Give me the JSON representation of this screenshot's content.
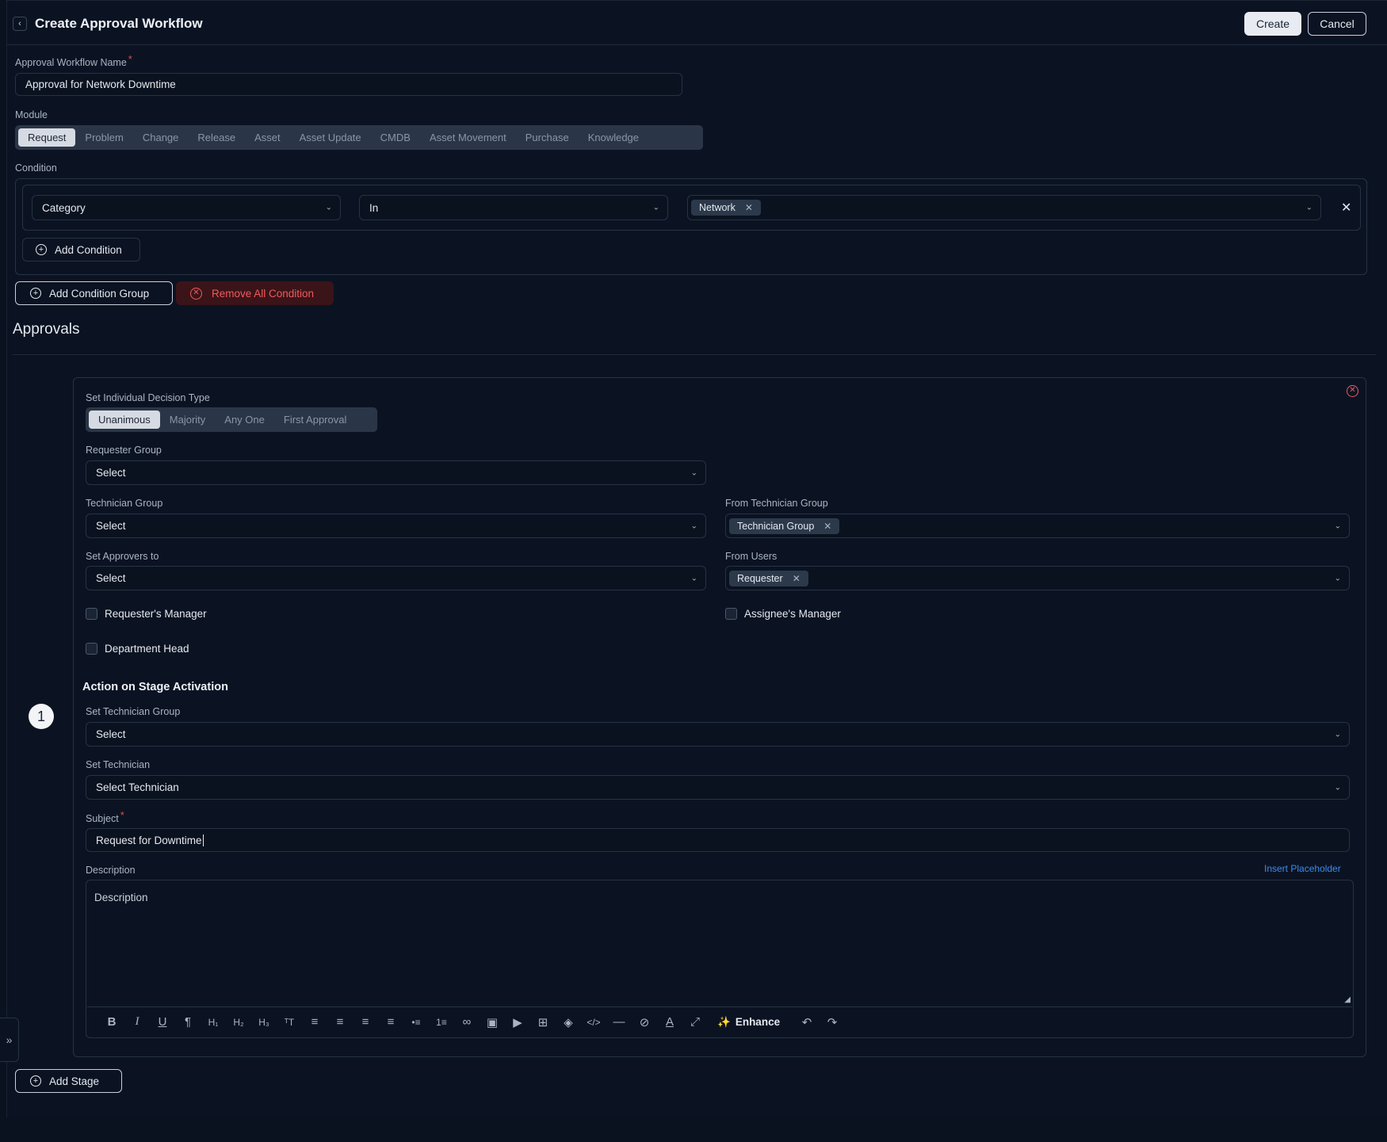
{
  "header": {
    "title": "Create Approval Workflow",
    "create_label": "Create",
    "cancel_label": "Cancel"
  },
  "workflow_name": {
    "label": "Approval Workflow Name",
    "required_mark": "*",
    "value": "Approval for Network Downtime"
  },
  "module": {
    "label": "Module",
    "options": [
      "Request",
      "Problem",
      "Change",
      "Release",
      "Asset",
      "Asset Update",
      "CMDB",
      "Asset Movement",
      "Purchase",
      "Knowledge"
    ],
    "selected": "Request"
  },
  "condition": {
    "label": "Condition",
    "field": "Category",
    "operator": "In",
    "value_tag": "Network",
    "add_condition_label": "Add Condition",
    "add_group_label": "Add Condition Group",
    "remove_all_label": "Remove All Condition"
  },
  "approvals": {
    "title": "Approvals",
    "stage_number": "1",
    "decision_type": {
      "label": "Set Individual Decision Type",
      "options": [
        "Unanimous",
        "Majority",
        "Any One",
        "First Approval"
      ],
      "selected": "Unanimous"
    },
    "requester_group": {
      "label": "Requester Group",
      "value": "Select"
    },
    "technician_group": {
      "label": "Technician Group",
      "value": "Select"
    },
    "from_technician_group": {
      "label": "From Technician Group",
      "tag": "Technician Group"
    },
    "set_approvers": {
      "label": "Set Approvers to",
      "value": "Select"
    },
    "from_users": {
      "label": "From Users",
      "tag": "Requester"
    },
    "checkboxes": {
      "requesters_manager": "Requester's Manager",
      "assignees_manager": "Assignee's Manager",
      "department_head": "Department Head"
    },
    "action": {
      "title": "Action on Stage Activation",
      "set_technician_group": {
        "label": "Set Technician Group",
        "value": "Select"
      },
      "set_technician": {
        "label": "Set Technician",
        "value": "Select Technician"
      },
      "subject": {
        "label": "Subject",
        "required_mark": "*",
        "value": "Request for Downtime"
      },
      "description": {
        "label": "Description",
        "placeholder": "Description",
        "insert_placeholder_label": "Insert Placeholder"
      },
      "enhance_label": "Enhance"
    },
    "add_stage_label": "Add Stage"
  },
  "icons": {
    "back": "chevron-left-icon",
    "close": "close-icon",
    "plus": "plus-circle-icon",
    "remove": "x-circle-icon",
    "expand": "double-chevron-right-icon"
  },
  "colors": {
    "background": "#0b1322",
    "border": "#263244",
    "danger": "#f05a5f",
    "link": "#3b8bf0"
  }
}
